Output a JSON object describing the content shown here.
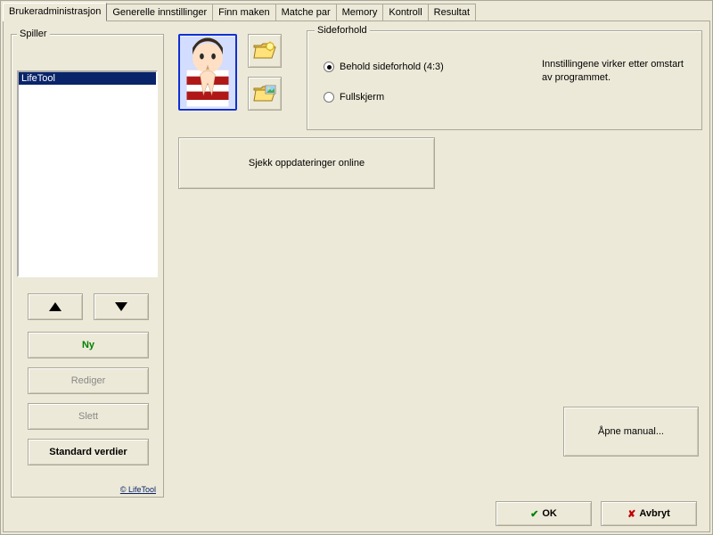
{
  "tabs": [
    {
      "label": "Brukeradministrasjon",
      "active": true
    },
    {
      "label": "Generelle innstillinger",
      "active": false
    },
    {
      "label": "Finn maken",
      "active": false
    },
    {
      "label": "Matche par",
      "active": false
    },
    {
      "label": "Memory",
      "active": false
    },
    {
      "label": "Kontroll",
      "active": false
    },
    {
      "label": "Resultat",
      "active": false
    }
  ],
  "player_panel": {
    "caption": "Spiller",
    "selected_item": "LifeTool",
    "buttons": {
      "new": "Ny",
      "edit": "Rediger",
      "delete": "Slett",
      "defaults": "Standard verdier"
    },
    "copyright": "© LifeTool"
  },
  "aspect": {
    "legend": "Sideforhold",
    "keep": "Behold sideforhold (4:3)",
    "fullscreen": "Fullskjerm",
    "info": "Innstillingene virker etter omstart av programmet.",
    "selected": "keep"
  },
  "buttons": {
    "check_updates": "Sjekk oppdateringer online",
    "open_manual": "Åpne manual...",
    "ok": "OK",
    "cancel": "Avbryt"
  }
}
